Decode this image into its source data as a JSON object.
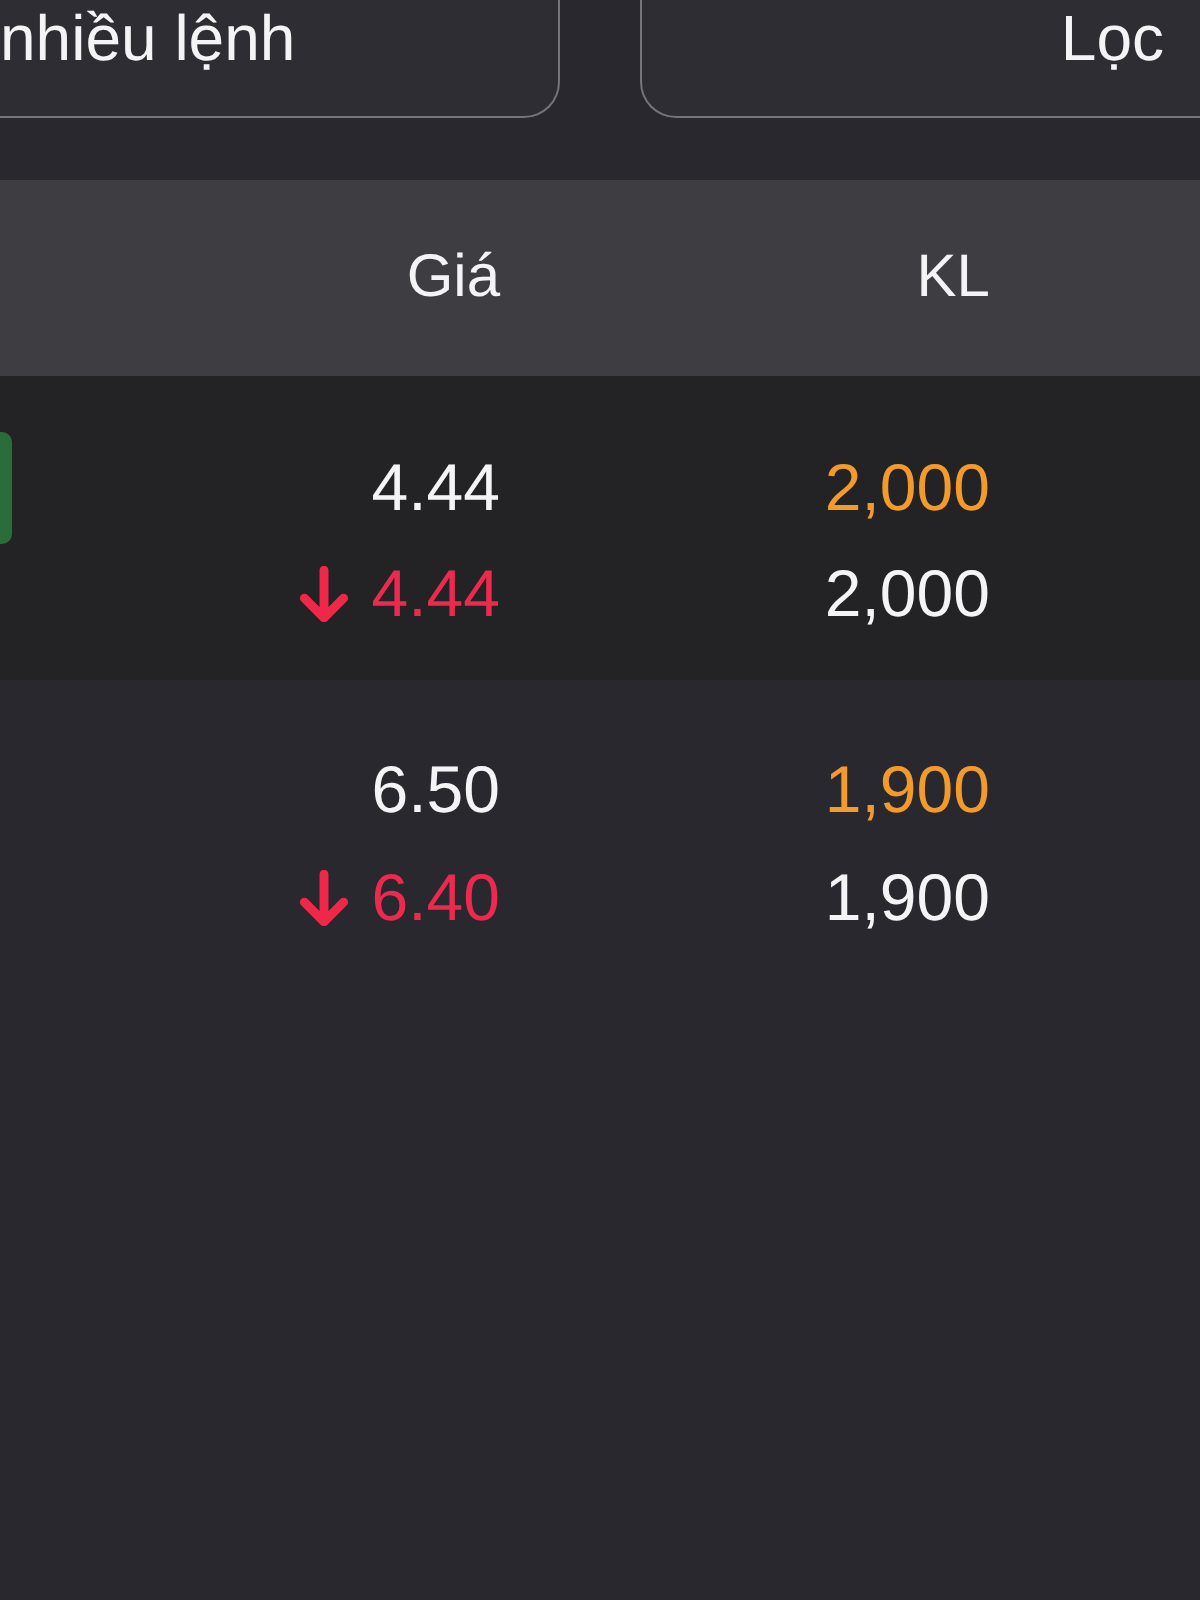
{
  "toolbar": {
    "buttons": [
      {
        "label": "nhiều lệnh"
      },
      {
        "label": "Lọc"
      }
    ]
  },
  "table": {
    "columns": [
      {
        "label": "Giá"
      },
      {
        "label": "KL"
      }
    ],
    "rows": [
      {
        "tagged": true,
        "lines": [
          {
            "kind": "order",
            "price": "4.44",
            "volume": "2,000",
            "falling": false
          },
          {
            "kind": "matched",
            "price": "4.44",
            "volume": "2,000",
            "falling": true
          }
        ]
      },
      {
        "tagged": false,
        "lines": [
          {
            "kind": "order",
            "price": "6.50",
            "volume": "1,900",
            "falling": false
          },
          {
            "kind": "matched",
            "price": "6.40",
            "volume": "1,900",
            "falling": true
          }
        ]
      }
    ]
  }
}
